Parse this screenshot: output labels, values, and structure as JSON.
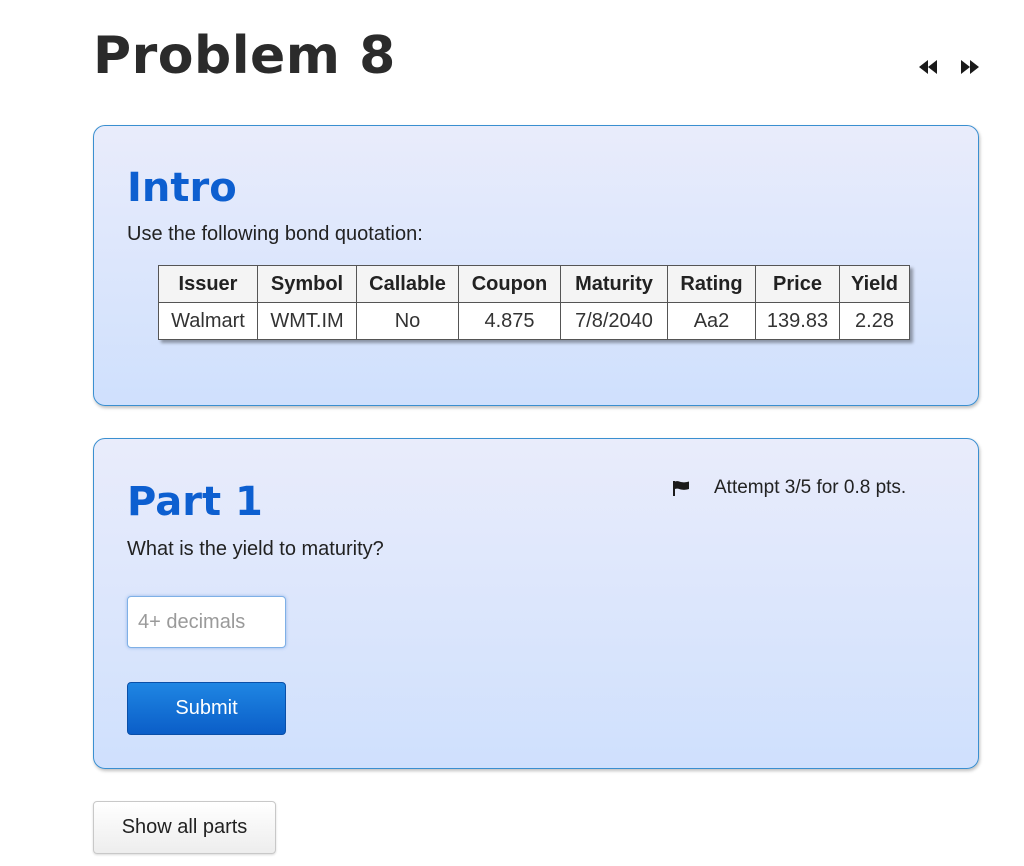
{
  "page": {
    "title": "Problem 8",
    "nav": {
      "prev_icon": "double-arrow-left-icon",
      "next_icon": "double-arrow-right-icon"
    }
  },
  "intro": {
    "heading": "Intro",
    "text": "Use the following bond quotation:",
    "table": {
      "headers": [
        "Issuer",
        "Symbol",
        "Callable",
        "Coupon",
        "Maturity",
        "Rating",
        "Price",
        "Yield"
      ],
      "rows": [
        [
          "Walmart",
          "WMT.IM",
          "No",
          "4.875",
          "7/8/2040",
          "Aa2",
          "139.83",
          "2.28"
        ]
      ]
    }
  },
  "part1": {
    "heading": "Part 1",
    "question": "What is the yield to maturity?",
    "attempt": "Attempt 3/5 for 0.8 pts.",
    "flag_icon": "flag-icon",
    "input": {
      "value": "",
      "placeholder": "4+ decimals"
    },
    "submit_label": "Submit"
  },
  "footer": {
    "show_all_label": "Show all parts"
  },
  "colors": {
    "heading_blue": "#0d5fd0",
    "card_border": "#3a8fd0",
    "submit_blue": "#0b5ec8"
  }
}
